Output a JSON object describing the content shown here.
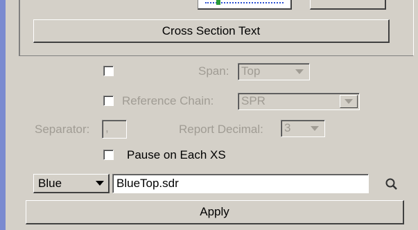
{
  "cross_section_button": "Cross Section Text",
  "span": {
    "label": "Span:",
    "value": "Top"
  },
  "reference_chain": {
    "label": "Reference Chain:",
    "value": "SPR"
  },
  "separator": {
    "label": "Separator:",
    "value": ","
  },
  "report_decimal": {
    "label": "Report Decimal:",
    "value": "3"
  },
  "pause": {
    "label": "Pause on Each XS"
  },
  "color_select": {
    "value": "Blue"
  },
  "file_field": {
    "value": "BlueTop.sdr"
  },
  "apply_button": "Apply",
  "colors": {
    "accent_strip": "#7a8ad0",
    "panel": "#d4d0c8",
    "disabled_text": "#a09c94"
  },
  "icons": {
    "search": "magnifier-icon",
    "dropdown": "triangle-down-icon"
  }
}
